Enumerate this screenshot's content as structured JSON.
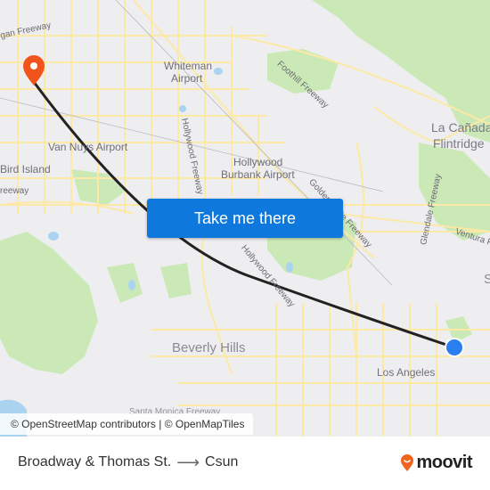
{
  "map": {
    "labels": {
      "van_freeway": "Ventura Freeway",
      "whiteman_airport_1": "Whiteman",
      "whiteman_airport_2": "Airport",
      "foothill_freeway": "Foothill Freeway",
      "la_canada_1": "La Cañada",
      "la_canada_2": "Flintridge",
      "hollywood_freeway_north": "Hollywood Freeway",
      "van_nuys_airport": "Van Nuys Airport",
      "bird_island": "Bird Island",
      "freeway_left": "reeway",
      "hollywood_burbank_1": "Hollywood",
      "hollywood_burbank_2": "Burbank Airport",
      "golden_state": "Golden State Freeway",
      "glendale_freeway": "Glendale Freeway",
      "ventura_freeway_east": "Ventura F",
      "hollywood_freeway_south": "Hollywood Freeway",
      "beverly_hills": "Beverly Hills",
      "los_angeles": "Los Angeles",
      "santa_monica_freeway": "Santa Monica Freeway",
      "s_edge": "S",
      "top_left_freeway": "gan Freeway"
    },
    "origin_marker": "Broadway & Thomas St.",
    "destination_marker": "Csun",
    "colors": {
      "route": "#222222",
      "origin": "#2a7ef0",
      "destination": "#f1531c",
      "roads": "#fce8a0",
      "parks": "#c8e8b0",
      "water": "#a8d4f0"
    }
  },
  "cta": {
    "label": "Take me there"
  },
  "attribution": "© OpenStreetMap contributors | © OpenMapTiles",
  "footer": {
    "origin": "Broadway & Thomas St.",
    "arrow": "⟶",
    "destination": "Csun",
    "brand": "moovit",
    "brand_color": "#f1641c"
  }
}
